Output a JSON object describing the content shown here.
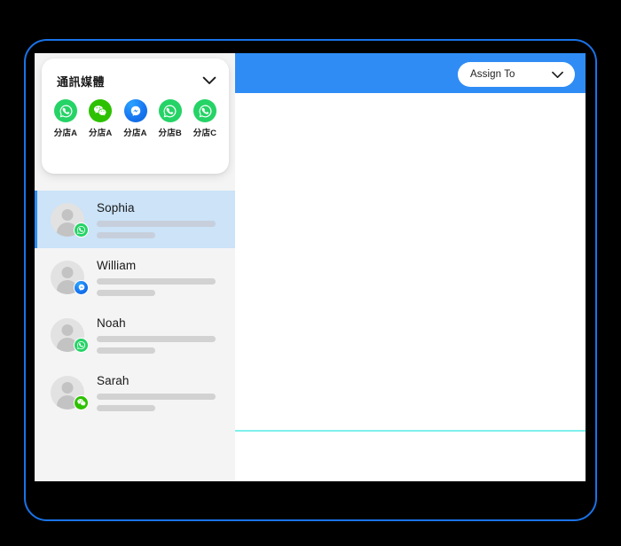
{
  "frame": {
    "outline_color": "#1a73e8",
    "background": "#000000"
  },
  "window": {
    "background": "#ffffff"
  },
  "sidebar": {
    "background": "#f4f4f4",
    "channel_card": {
      "title": "通訊媒體",
      "collapse_icon": "chevron-down-icon",
      "channels": [
        {
          "icon": "whatsapp-icon",
          "type": "whatsapp",
          "label": "分店A",
          "color": "#25D366"
        },
        {
          "icon": "wechat-icon",
          "type": "wechat",
          "label": "分店A",
          "color": "#2DC100"
        },
        {
          "icon": "messenger-icon",
          "type": "messenger",
          "label": "分店A",
          "color": "#1877f2"
        },
        {
          "icon": "whatsapp-icon",
          "type": "whatsapp",
          "label": "分店B",
          "color": "#25D366"
        },
        {
          "icon": "whatsapp-icon",
          "type": "whatsapp",
          "label": "分店C",
          "color": "#25D366"
        }
      ]
    },
    "contacts": [
      {
        "name": "Sophia",
        "channel": "whatsapp",
        "channel_icon": "whatsapp-icon",
        "selected": true
      },
      {
        "name": "William",
        "channel": "messenger",
        "channel_icon": "messenger-icon",
        "selected": false
      },
      {
        "name": "Noah",
        "channel": "whatsapp",
        "channel_icon": "whatsapp-icon",
        "selected": false
      },
      {
        "name": "Sarah",
        "channel": "wechat",
        "channel_icon": "wechat-icon",
        "selected": false
      }
    ],
    "selection_accent": "#2f8cf5",
    "selection_background": "#cce3f8"
  },
  "main": {
    "header": {
      "background": "#2f8cf5",
      "assign_to": {
        "label": "Assign To",
        "chevron_icon": "chevron-down-icon"
      }
    },
    "divider": {
      "color": "#7ff0ec"
    }
  }
}
